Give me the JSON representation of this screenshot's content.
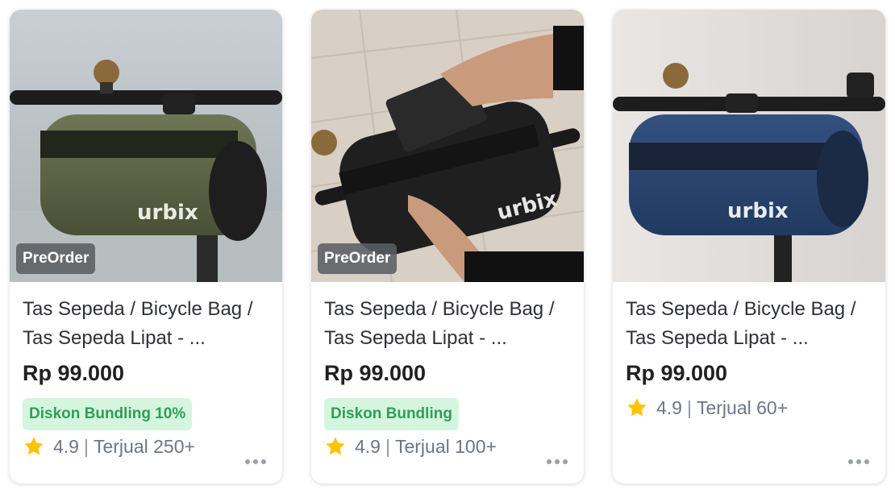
{
  "colors": {
    "badge_bg": "#5a5f64",
    "discount_bg": "#d6f5df",
    "discount_text": "#2f9e58",
    "star": "#ffc400",
    "meta_text": "#6d7588"
  },
  "products": [
    {
      "badge": "PreOrder",
      "image_brand": "urbix",
      "bag_color": "olive green",
      "title": "Tas Sepeda / Bicycle Bag / Tas Sepeda Lipat - ...",
      "price": "Rp 99.000",
      "discount": "Diskon Bundling 10%",
      "rating": "4.9",
      "sold": "Terjual 250+",
      "rating_icon": "star-icon",
      "more_icon": "more-dots-icon"
    },
    {
      "badge": "PreOrder",
      "image_brand": "urbix",
      "bag_color": "black",
      "title": "Tas Sepeda / Bicycle Bag / Tas Sepeda Lipat - ...",
      "price": "Rp 99.000",
      "discount": "Diskon Bundling",
      "rating": "4.9",
      "sold": "Terjual 100+",
      "rating_icon": "star-icon",
      "more_icon": "more-dots-icon"
    },
    {
      "image_brand": "urbix",
      "bag_color": "navy blue",
      "title": "Tas Sepeda / Bicycle Bag / Tas Sepeda Lipat - ...",
      "price": "Rp 99.000",
      "rating": "4.9",
      "sold": "Terjual 60+",
      "rating_icon": "star-icon",
      "more_icon": "more-dots-icon"
    }
  ]
}
